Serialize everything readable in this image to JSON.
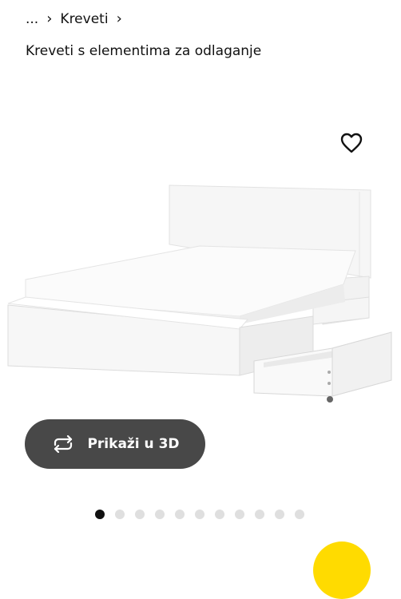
{
  "breadcrumb": {
    "ellipsis": "...",
    "separator": "›",
    "current": "Kreveti"
  },
  "page": {
    "subtitle": "Kreveti s elementima za odlaganje"
  },
  "product": {
    "favorite_icon": "heart-outline-icon"
  },
  "view3d": {
    "label": "Prikaži u 3D",
    "icon": "rotate-3d-icon"
  },
  "carousel": {
    "total": 11,
    "active_index": 0
  },
  "colors": {
    "button_bg": "#484848",
    "dot_active": "#111111",
    "dot_inactive": "#dfdfdf",
    "fab": "#ffdb00"
  }
}
